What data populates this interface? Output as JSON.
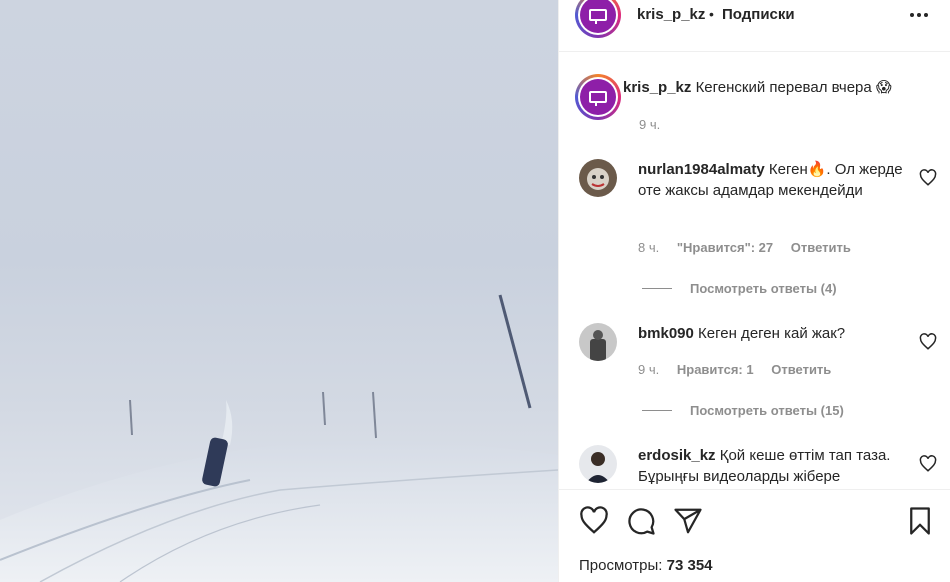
{
  "post": {
    "username": "kris_p_kz",
    "separator": "•",
    "follow_label": "Подписки",
    "caption_user": "kris_p_kz",
    "caption_text": "Кегенский перевал вчера 😱",
    "caption_time": "9 ч."
  },
  "comments": [
    {
      "user": "nurlan1984almaty",
      "text": "Кеген🔥. Ол жерде оте жаксы адамдар мекендейди",
      "time": "8 ч.",
      "likes": "\"Нравится\": 27",
      "reply": "Ответить",
      "view_replies": "Посмотреть ответы (4)"
    },
    {
      "user": "bmk090",
      "text": "Кеген деген кай жак?",
      "time": "9 ч.",
      "likes": "Нравится: 1",
      "reply": "Ответить",
      "view_replies": "Посмотреть ответы (15)"
    },
    {
      "user": "erdosik_kz",
      "text": "Қой кеше өттім тап таза. Бұрыңғы видеоларды жібере"
    }
  ],
  "actions": {
    "views_label": "Просмотры:",
    "views_count": "73 354"
  },
  "icons": [
    "more-icon",
    "heart-icon",
    "comment-icon",
    "share-icon",
    "bookmark-icon"
  ],
  "colors": {
    "brand_avatar": "#8e1fa8",
    "muted": "#8e8e8e",
    "text": "#262626"
  }
}
